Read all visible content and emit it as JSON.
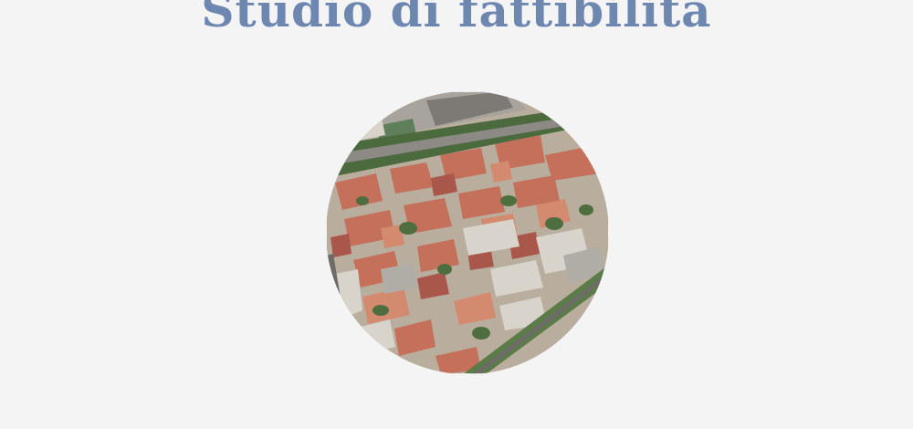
{
  "page": {
    "title": "Studio di fattibilità"
  },
  "image": {
    "alt": "Aerial view of an urban neighborhood",
    "shape": "circle"
  },
  "colors": {
    "background": "#f4f4f4",
    "title": "#6d87b0"
  }
}
